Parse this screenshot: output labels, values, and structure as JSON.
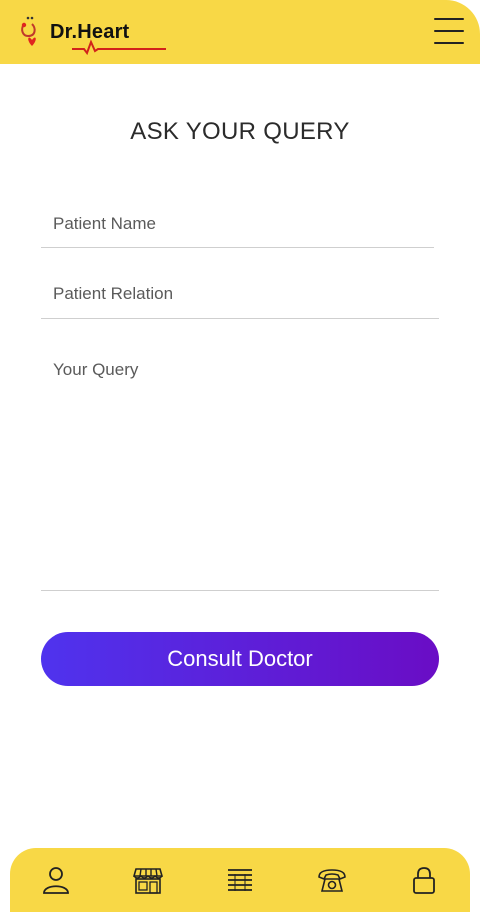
{
  "header": {
    "logo_prefix": "Dr.",
    "logo_name": "Heart",
    "menu_icon": "hamburger-menu-icon",
    "accent_color": "#f8d846"
  },
  "page": {
    "title": "ASK YOUR QUERY"
  },
  "form": {
    "patient_name_placeholder": "Patient Name",
    "patient_relation_placeholder": "Patient Relation",
    "query_placeholder": "Your Query",
    "submit_label": "Consult Doctor",
    "button_gradient": [
      "#4f33ee",
      "#6a0dc5"
    ]
  },
  "bottom_nav": {
    "items": [
      {
        "icon": "user-icon"
      },
      {
        "icon": "store-icon"
      },
      {
        "icon": "list-icon"
      },
      {
        "icon": "phone-icon"
      },
      {
        "icon": "lock-icon"
      }
    ]
  }
}
